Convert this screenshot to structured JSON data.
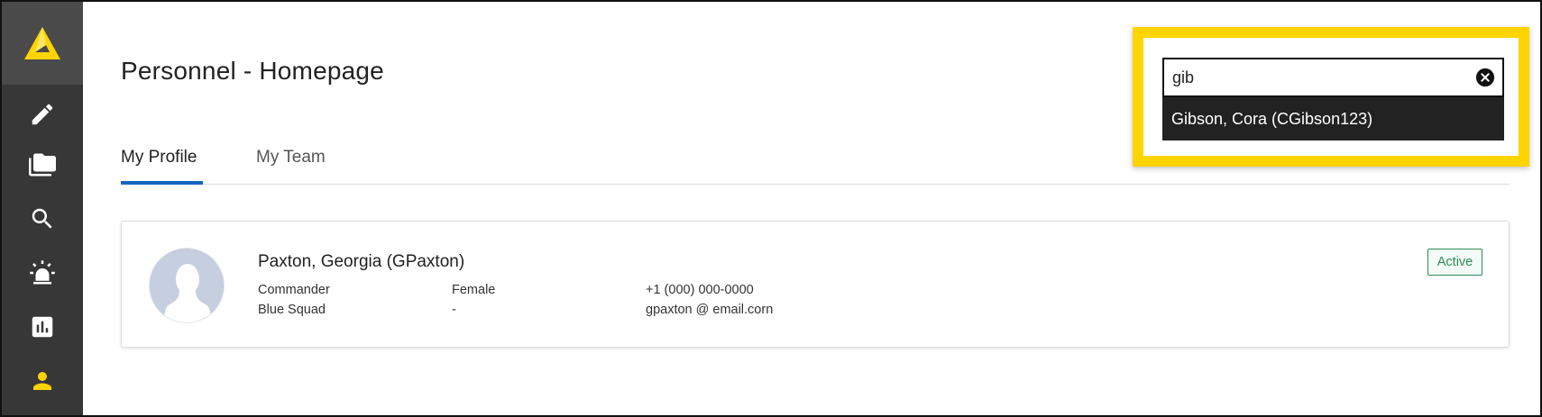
{
  "page": {
    "title": "Personnel - Homepage"
  },
  "tabs": [
    {
      "label": "My Profile",
      "active": true
    },
    {
      "label": "My Team",
      "active": false
    }
  ],
  "sidebar": {
    "logo": "triangle-logo",
    "items": [
      {
        "icon": "pencil-icon"
      },
      {
        "icon": "folders-icon"
      },
      {
        "icon": "search-icon"
      },
      {
        "icon": "alarm-light-icon"
      },
      {
        "icon": "bar-chart-icon"
      },
      {
        "icon": "person-icon",
        "active": true
      }
    ],
    "active_color": "#ffd400"
  },
  "search": {
    "value": "gib",
    "suggestions": [
      "Gibson, Cora (CGibson123)"
    ]
  },
  "profile": {
    "name": "Paxton, Georgia (GPaxton)",
    "rank": "Commander",
    "unit": "Blue Squad",
    "gender": "Female",
    "gender_secondary": "-",
    "phone": "+1 (000) 000-0000",
    "email": "gpaxton @ email.corn",
    "status": "Active",
    "status_color": "#2e8b57"
  },
  "colors": {
    "accent": "#1565c0",
    "highlight": "#ffd400",
    "sidebar": "#373737"
  }
}
